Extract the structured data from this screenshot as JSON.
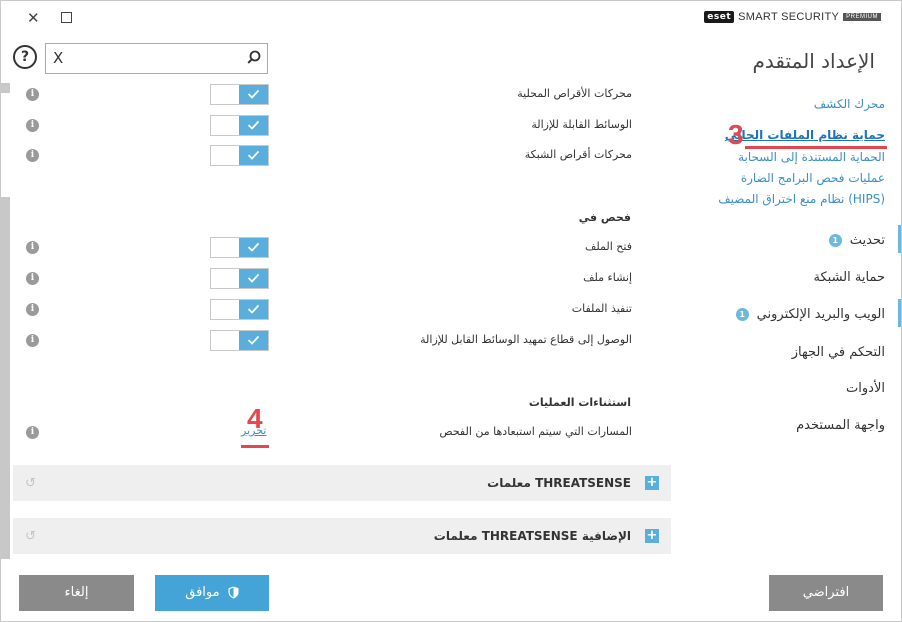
{
  "window": {
    "close_glyph": "✕",
    "brand_logo": "eset",
    "brand_name": "SMART SECURITY",
    "brand_tier": "PREMIUM"
  },
  "sidebar": {
    "title": "الإعداد المتقدم",
    "sub_items": [
      {
        "label": "محرك الكشف",
        "active": false
      },
      {
        "label": "حماية نظام الملفات الحالي",
        "active": true
      },
      {
        "label": "الحماية المستندة إلى السحابة",
        "active": false
      },
      {
        "label": "عمليات فحص البرامج الضارة",
        "active": false
      },
      {
        "label": "نظام منع اختراق المضيف (HIPS)",
        "active": false
      }
    ],
    "items": [
      {
        "label": "تحديث",
        "badge": "1"
      },
      {
        "label": "حماية الشبكة",
        "badge": ""
      },
      {
        "label": "الويب والبريد الإلكتروني",
        "badge": "1"
      },
      {
        "label": "التحكم في الجهاز",
        "badge": ""
      },
      {
        "label": "الأدوات",
        "badge": ""
      },
      {
        "label": "واجهة المستخدم",
        "badge": ""
      }
    ],
    "step_marker": "3"
  },
  "search": {
    "clear_glyph": "X",
    "value": ""
  },
  "media_rows": [
    {
      "label": "محركات الأقراص المحلية",
      "enabled": true
    },
    {
      "label": "الوسائط القابلة للإزالة",
      "enabled": true
    },
    {
      "label": "محركات أقراص الشبكة",
      "enabled": true
    }
  ],
  "scan_on": {
    "title": "فحص في",
    "rows": [
      {
        "label": "فتح الملف",
        "enabled": true
      },
      {
        "label": "إنشاء ملف",
        "enabled": true
      },
      {
        "label": "تنفيذ الملفات",
        "enabled": true
      },
      {
        "label": "الوصول إلى قطاع تمهيد الوسائط القابل للإزالة",
        "enabled": true
      }
    ]
  },
  "exclusions": {
    "title": "استثناءات العمليات",
    "row_label": "المسارات التي سيتم استبعادها من الفحص",
    "edit_label": "تحرير",
    "step_marker": "4"
  },
  "groups": [
    {
      "label": "معلمات THREATSENSE"
    },
    {
      "label": "معلمات THREATSENSE الإضافية"
    }
  ],
  "footer": {
    "cancel_label": "إلغاء",
    "ok_label": "موافق",
    "default_label": "افتراضي"
  },
  "colors": {
    "accent": "#44a4d8",
    "link": "#3a8fc7",
    "marker": "#e2474f",
    "button_gray": "#8a8a8a"
  }
}
